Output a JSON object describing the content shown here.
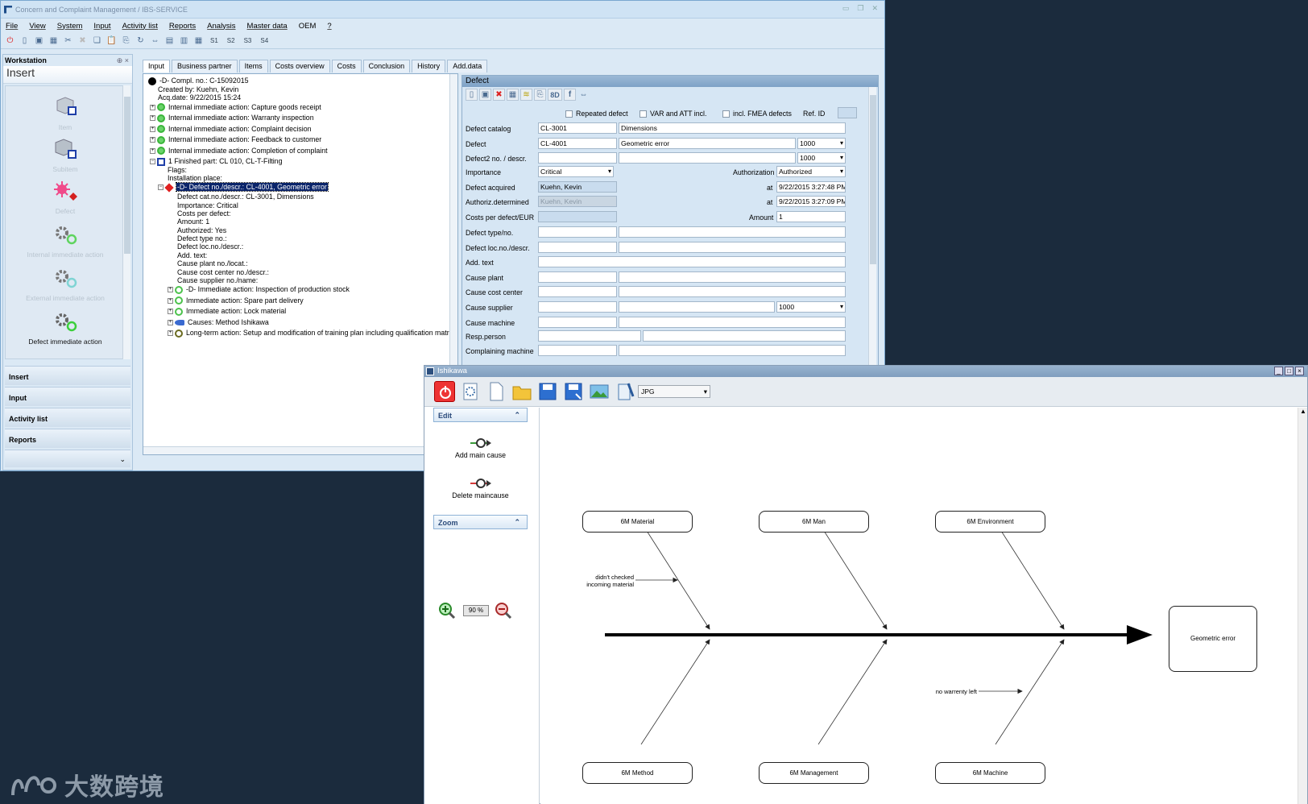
{
  "main_window": {
    "title": "Concern and Complaint Management / IBS-SERVICE",
    "menu": [
      "File",
      "View",
      "System",
      "Input",
      "Activity list",
      "Reports",
      "Analysis",
      "Master data",
      "OEM",
      "?"
    ],
    "toolbar_text": [
      "S1",
      "S2",
      "S3",
      "S4"
    ]
  },
  "sidebar": {
    "header": "Workstation",
    "pin_close": "⊕ ×",
    "insert_title": "Insert",
    "icons": [
      {
        "label": "Item",
        "icon": "item-icon"
      },
      {
        "label": "Subitem",
        "icon": "subitem-icon"
      },
      {
        "label": "Defect",
        "icon": "defect-icon"
      },
      {
        "label": "Internal immediate action",
        "icon": "internal-action-icon"
      },
      {
        "label": "External immediate action",
        "icon": "external-action-icon"
      },
      {
        "label": "Defect immediate action",
        "icon": "defect-action-icon"
      }
    ],
    "nav": [
      "Insert",
      "Input",
      "Activity list",
      "Reports"
    ]
  },
  "tabs": [
    "Input",
    "Business partner",
    "Items",
    "Costs overview",
    "Costs",
    "Conclusion",
    "History",
    "Add.data"
  ],
  "tree": [
    {
      "text": "-D- Compl. no.: C-15092015",
      "indent": 0
    },
    {
      "text": "Created by: Kuehn, Kevin",
      "indent": 1
    },
    {
      "text": "Acq.date: 9/22/2015 15:24",
      "indent": 1
    },
    {
      "text": "Internal immediate action: Capture goods receipt",
      "indent": 1
    },
    {
      "text": "Internal immediate action: Warranty inspection",
      "indent": 1
    },
    {
      "text": "Internal immediate action: Complaint decision",
      "indent": 1
    },
    {
      "text": "Internal immediate action: Feedback to customer",
      "indent": 1
    },
    {
      "text": "Internal immediate action: Completion of complaint",
      "indent": 1
    },
    {
      "text": "1 Finished part: CL 010, CL-T-Filting",
      "indent": 1
    },
    {
      "text": "Flags:",
      "indent": 2
    },
    {
      "text": "Installation place:",
      "indent": 2
    },
    {
      "text": "-D- Defect no./descr.: CL-4001, Geometric error",
      "indent": 2
    },
    {
      "text": "Defect cat.no./descr.: CL-3001, Dimensions",
      "indent": 3
    },
    {
      "text": "Importance: Critical",
      "indent": 3
    },
    {
      "text": "Costs per defect:",
      "indent": 3
    },
    {
      "text": "Amount: 1",
      "indent": 3
    },
    {
      "text": "Authorized: Yes",
      "indent": 3
    },
    {
      "text": "Defect type no.:",
      "indent": 3
    },
    {
      "text": "Defect loc.no./descr.:",
      "indent": 3
    },
    {
      "text": "Add. text:",
      "indent": 3
    },
    {
      "text": "Cause plant no./locat.:",
      "indent": 3
    },
    {
      "text": "Cause cost center no./descr.:",
      "indent": 3
    },
    {
      "text": "Cause supplier no./name:",
      "indent": 3
    },
    {
      "text": "-D- Immediate action: Inspection of production stock",
      "indent": 3
    },
    {
      "text": "Immediate action: Spare part delivery",
      "indent": 3
    },
    {
      "text": "Immediate action: Lock material",
      "indent": 3
    },
    {
      "text": "Causes: Method Ishikawa",
      "indent": 3
    },
    {
      "text": "Long-term action: Setup and modification of training plan including qualification matrix",
      "indent": 3
    }
  ],
  "defect": {
    "title": "Defect",
    "toolbar_8d": "8D",
    "toolbar_f": "f",
    "checks": {
      "repeated": "Repeated defect",
      "var": "VAR and ATT incl.",
      "fmea": "incl. FMEA defects",
      "refid": "Ref. ID"
    },
    "labels": {
      "catalog": "Defect catalog",
      "defect": "Defect",
      "defect2": "Defect2 no. / descr.",
      "importance": "Importance",
      "acquired": "Defect acquired",
      "authdet": "Authoriz.determined",
      "costs": "Costs per defect/EUR",
      "type": "Defect type/no.",
      "loc": "Defect loc.no./descr.",
      "addtext": "Add. text",
      "plant": "Cause plant",
      "costcenter": "Cause cost center",
      "supplier": "Cause supplier",
      "machine": "Cause machine",
      "resp": "Resp.person",
      "complaining": "Complaining machine",
      "authorization": "Authorization",
      "at1": "at",
      "at2": "at",
      "amount": "Amount"
    },
    "values": {
      "catalog_no": "CL-3001",
      "catalog_desc": "Dimensions",
      "defect_no": "CL-4001",
      "defect_desc": "Geometric error",
      "defect_qty": "1000",
      "defect2_qty": "1000",
      "importance": "Critical",
      "authorization": "Authorized",
      "acquired_by": "Kuehn, Kevin",
      "acquired_at": "9/22/2015 3:27:48 PM",
      "auth_by": "Kuehn, Kevin",
      "auth_at": "9/22/2015 3:27:09 PM",
      "amount": "1",
      "supplier_qty": "1000"
    }
  },
  "ishikawa": {
    "title": "Ishikawa",
    "format": "JPG",
    "edit_header": "Edit",
    "add_main_cause": "Add main cause",
    "delete_main_cause": "Delete maincause",
    "zoom_header": "Zoom",
    "zoom_value": "90 %",
    "categories_top": [
      "6M Material",
      "6M Man",
      "6M Environment"
    ],
    "categories_bottom": [
      "6M Method",
      "6M Management",
      "6M Machine"
    ],
    "effect": "Geometric error",
    "notes": {
      "material": "didn't checked\nincoming material",
      "machine": "no warrenty left"
    }
  },
  "watermark": "大数跨境"
}
